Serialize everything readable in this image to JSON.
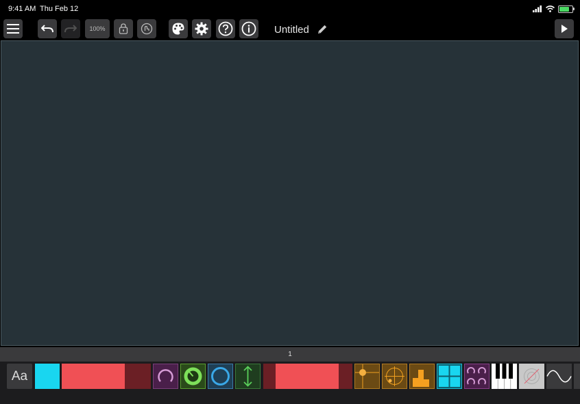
{
  "status": {
    "time": "9:41 AM",
    "date": "Thu Feb 12"
  },
  "toolbar": {
    "zoom": "100%",
    "title": "Untitled",
    "icons": [
      "menu-icon",
      "undo-icon",
      "redo-icon",
      "lock-icon",
      "gesture-icon",
      "palette-icon",
      "gear-icon",
      "help-icon",
      "info-icon",
      "edit-icon",
      "play-icon"
    ]
  },
  "pagebar": {
    "page": "1"
  },
  "palette": {
    "text_label": "Aa",
    "items": [
      "text",
      "color-block",
      "horizontal-fader",
      "knob",
      "encoder",
      "radial",
      "vertical-slider",
      "range-fader",
      "xy-pad",
      "radar",
      "multi-slider",
      "grid",
      "pads",
      "keyboard",
      "scope",
      "waveform"
    ]
  },
  "colors": {
    "canvas": "#263238",
    "accent_red": "#f05055",
    "accent_cyan": "#19d6f0",
    "battery": "#4cd964"
  }
}
